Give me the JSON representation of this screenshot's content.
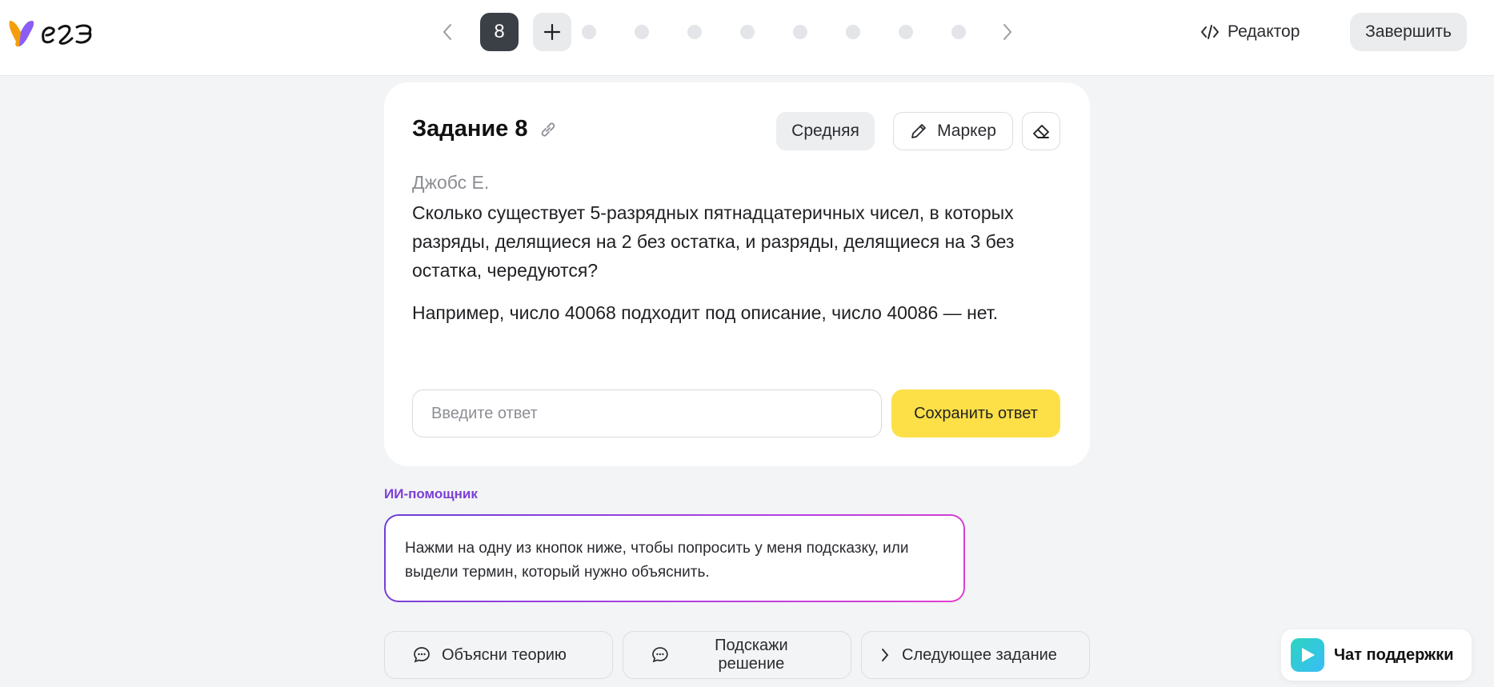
{
  "header": {
    "logo_icon": "yandex-uchebnik-logo",
    "current_task": "8",
    "editor_label": "Редактор",
    "finish_label": "Завершить"
  },
  "task": {
    "title": "Задание 8",
    "difficulty": "Средняя",
    "marker_label": "Маркер",
    "author": "Джобс Е.",
    "text": "Сколько существует 5-разрядных пятнадцатеричных чисел, в которых разряды, делящиеся на 2 без остатка, и разряды, делящиеся на 3 без остатка, чередуются?",
    "example": "Например, число 40068 подходит под описание, число 40086 — нет.",
    "answer_placeholder": "Введите ответ",
    "save_label": "Сохранить ответ"
  },
  "assistant": {
    "label": "ИИ-помощник",
    "message": "Нажми на одну из кнопок ниже, чтобы попросить у меня подсказку, или выдели термин, который нужно объяснить.",
    "actions": [
      {
        "label": "Объясни теорию",
        "icon": "chat-bubble-icon"
      },
      {
        "label": "Подскажи решение",
        "icon": "chat-bubble-icon"
      },
      {
        "label": "Следующее задание",
        "icon": "chevron-right-icon"
      }
    ]
  },
  "support": {
    "label": "Чат поддержки"
  },
  "colors": {
    "accent_yellow": "#fde047",
    "assistant_purple": "#7b3fd6",
    "current_page_bg": "#3b3f46"
  }
}
